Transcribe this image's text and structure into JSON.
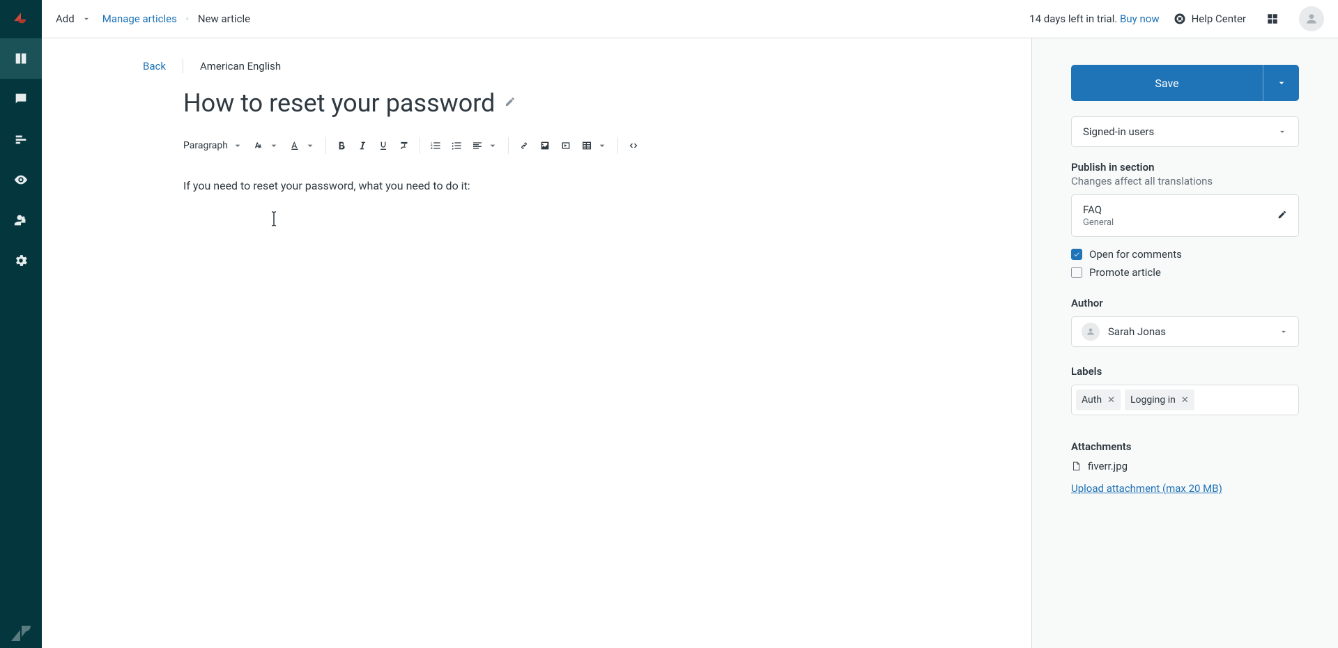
{
  "rail": {
    "items": [
      {
        "name": "knowledge",
        "active": true
      },
      {
        "name": "feedback",
        "active": false
      },
      {
        "name": "arrange",
        "active": false
      },
      {
        "name": "preview",
        "active": false
      },
      {
        "name": "permissions",
        "active": false
      },
      {
        "name": "settings",
        "active": false
      }
    ]
  },
  "topbar": {
    "add_label": "Add",
    "crumb_manage": "Manage articles",
    "crumb_current": "New article",
    "trial_text": "14 days left in trial. ",
    "trial_link": "Buy now",
    "help_center": "Help Center"
  },
  "editor": {
    "back": "Back",
    "locale": "American English",
    "title": "How to reset your password",
    "body": "If you need to reset your password, what you need to do it:",
    "paragraph_label": "Paragraph"
  },
  "sidebar": {
    "save": "Save",
    "visibility": {
      "selected": "Signed-in users"
    },
    "publish_heading": "Publish in section",
    "publish_sub": "Changes affect all translations",
    "section": {
      "title": "FAQ",
      "subtitle": "General"
    },
    "open_comments": {
      "label": "Open for comments",
      "checked": true
    },
    "promote": {
      "label": "Promote article",
      "checked": false
    },
    "author_heading": "Author",
    "author": {
      "name": "Sarah Jonas"
    },
    "labels_heading": "Labels",
    "labels": [
      "Auth",
      "Logging in"
    ],
    "attachments_heading": "Attachments",
    "attachments": [
      "fiverr.jpg"
    ],
    "upload_link": "Upload attachment (max 20 MB)"
  }
}
